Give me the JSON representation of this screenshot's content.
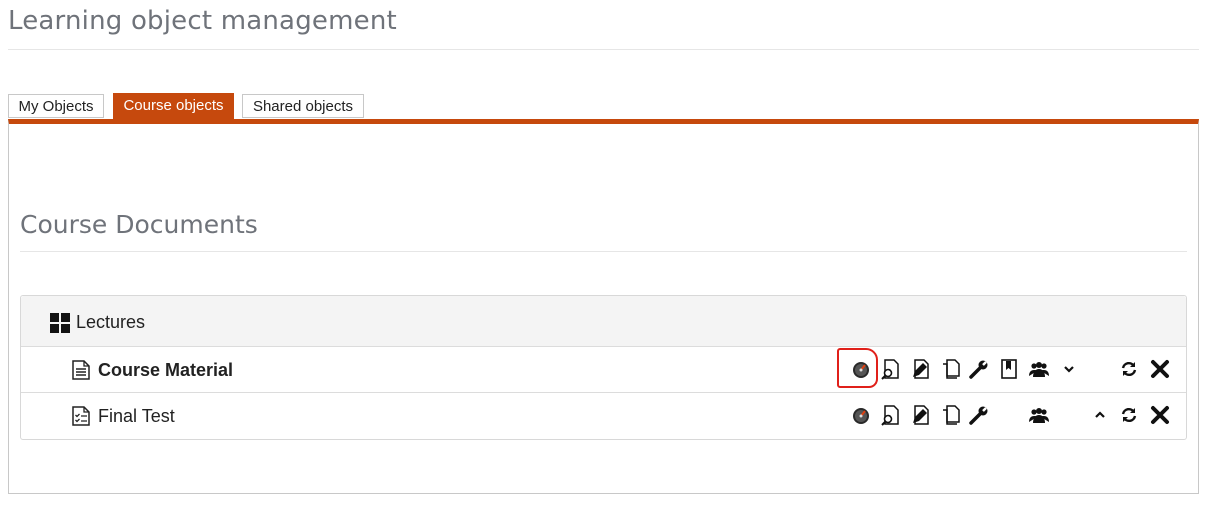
{
  "page": {
    "title": "Learning object management"
  },
  "tabs": [
    {
      "label": "My Objects",
      "active": false
    },
    {
      "label": "Course objects",
      "active": true
    },
    {
      "label": "Shared objects",
      "active": false
    }
  ],
  "section": {
    "title": "Course Documents"
  },
  "tree": {
    "folder": {
      "label": "Lectures",
      "icon": "grid-icon"
    },
    "rows": [
      {
        "label": "Course Material",
        "icon": "document-icon",
        "actions": [
          "statistics-icon",
          "preview-icon",
          "edit-icon",
          "copy-icon",
          "settings-wrench-icon",
          "bookmark-icon",
          "group-users-icon",
          "move-down-icon",
          "refresh-icon",
          "delete-icon"
        ],
        "highlighted_action": "statistics-icon"
      },
      {
        "label": "Final Test",
        "icon": "test-checklist-icon",
        "actions": [
          "statistics-icon",
          "preview-icon",
          "edit-icon",
          "copy-icon",
          "settings-wrench-icon",
          "group-users-icon",
          "move-up-icon",
          "refresh-icon",
          "delete-icon"
        ]
      }
    ]
  },
  "colors": {
    "accent": "#c6490d",
    "highlight": "#e0201a",
    "title_gray": "#6f737a"
  }
}
